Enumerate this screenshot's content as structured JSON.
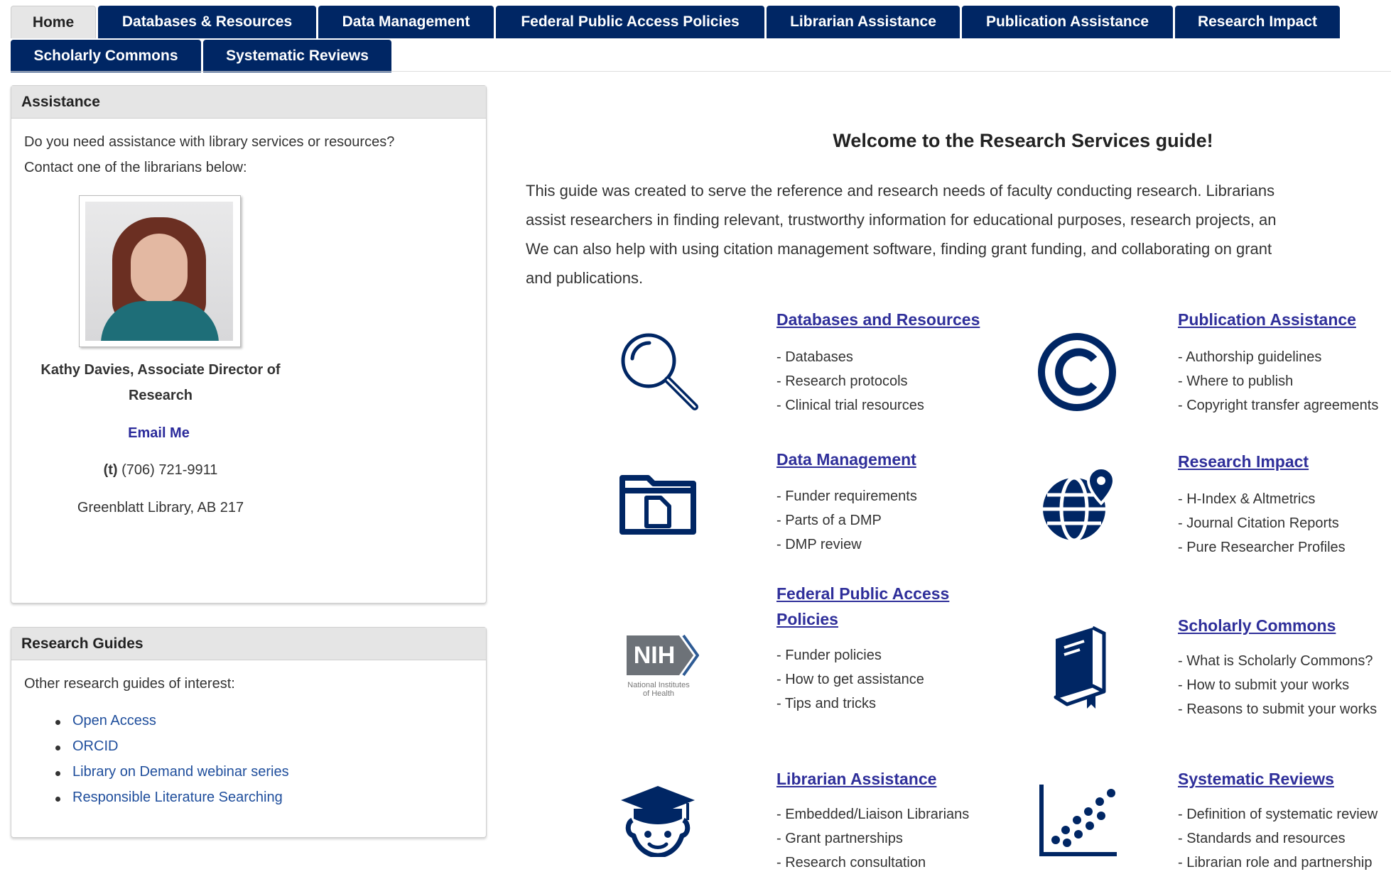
{
  "tabs": {
    "row1": [
      "Home",
      "Databases & Resources",
      "Data Management",
      "Federal Public Access Policies",
      "Librarian Assistance",
      "Publication Assistance",
      "Research Impact"
    ],
    "row2": [
      "Scholarly Commons",
      "Systematic Reviews"
    ],
    "active": "Home"
  },
  "assistance": {
    "title": "Assistance",
    "line1": "Do you need assistance with library services or resources?",
    "line2": "Contact one of the librarians below:",
    "name_line1": "Kathy Davies, Associate Director of",
    "name_line2": "Research",
    "email_label": "Email Me",
    "phone_prefix": "(t)",
    "phone": "(706) 721-9911",
    "location": "Greenblatt Library, AB 217"
  },
  "guides": {
    "title": "Research Guides",
    "intro": "Other research guides of interest:",
    "items": [
      "Open Access",
      "ORCID",
      "Library on Demand webinar series",
      "Responsible Literature Searching"
    ]
  },
  "main": {
    "welcome": "Welcome to the Research Services guide!",
    "intro_lines": [
      "This guide was created to serve the reference and research needs of faculty conducting research. Librarians",
      "assist researchers in finding relevant, trustworthy information for educational purposes, research projects, an",
      "We can also help with using citation management software, finding grant funding, and collaborating on grant",
      "and publications."
    ],
    "sections": {
      "databases": {
        "title": "Databases and Resources",
        "icon": "magnifier-icon",
        "items": [
          "- Databases",
          "- Research protocols",
          "- Clinical trial resources"
        ]
      },
      "publication": {
        "title": "Publication Assistance",
        "icon": "copyright-icon",
        "items": [
          "- Authorship guidelines",
          "- Where to publish",
          "- Copyright transfer agreements"
        ]
      },
      "data": {
        "title": "Data Management",
        "icon": "folder-icon",
        "items": [
          "- Funder requirements",
          "- Parts of a DMP",
          "- DMP review"
        ]
      },
      "impact": {
        "title": "Research Impact",
        "icon": "globe-pin-icon",
        "items": [
          "- H-Index & Altmetrics",
          "- Journal Citation Reports",
          "- Pure Researcher Profiles"
        ]
      },
      "federal": {
        "title_line1": "Federal Public Access",
        "title_line2": "Policies",
        "icon": "nih-logo",
        "nih_text": "NIH",
        "nih_sub1": "National Institutes",
        "nih_sub2": "of Health",
        "items": [
          "- Funder policies",
          "- How to get assistance",
          "- Tips and tricks"
        ]
      },
      "scholarly": {
        "title": "Scholarly Commons",
        "icon": "book-icon",
        "items": [
          "- What is Scholarly Commons?",
          "- How to submit your works",
          "- Reasons to submit your works"
        ]
      },
      "librarian": {
        "title": "Librarian Assistance",
        "icon": "graduate-icon",
        "items": [
          "- Embedded/Liaison Librarians",
          "- Grant partnerships",
          "- Research consultation"
        ]
      },
      "systematic": {
        "title": "Systematic Reviews",
        "icon": "scatter-plot-icon",
        "items": [
          "- Definition of systematic review",
          "- Standards and resources",
          "- Librarian role and partnership"
        ]
      }
    }
  },
  "colors": {
    "navy": "#002664",
    "link": "#2f2f9a",
    "list_link": "#1f4e9c"
  }
}
